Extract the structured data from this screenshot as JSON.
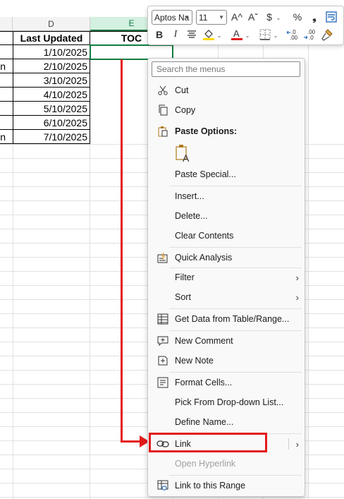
{
  "columns": {
    "d": "D",
    "e": "E"
  },
  "table": {
    "header_last_updated": "Last Updated",
    "header_toc": "TOC",
    "left_fragments": [
      "",
      "on",
      "",
      "",
      "",
      "",
      "n"
    ],
    "dates": [
      "1/10/2025",
      "2/10/2025",
      "3/10/2025",
      "4/10/2025",
      "5/10/2025",
      "6/10/2025",
      "7/10/2025"
    ]
  },
  "mini_toolbar": {
    "font_name": "Aptos Na",
    "font_size": "11",
    "grow_font": "A^",
    "shrink_font": "Aˇ",
    "currency": "$",
    "percent": "%",
    "comma": "❟",
    "bold": "B",
    "italic": "I",
    "font_color_accent": "#e31b1b",
    "highlight_accent": "#ffd800"
  },
  "menu": {
    "search_placeholder": "Search the menus",
    "cut": "Cut",
    "copy": "Copy",
    "paste_options": "Paste Options:",
    "paste_special": "Paste Special...",
    "insert": "Insert...",
    "delete": "Delete...",
    "clear_contents": "Clear Contents",
    "quick_analysis": "Quick Analysis",
    "filter": "Filter",
    "sort": "Sort",
    "get_data": "Get Data from Table/Range...",
    "new_comment": "New Comment",
    "new_note": "New Note",
    "format_cells": "Format Cells...",
    "pick_dropdown": "Pick From Drop-down List...",
    "define_name": "Define Name...",
    "link": "Link",
    "open_hyperlink": "Open Hyperlink",
    "link_to_range": "Link to this Range"
  },
  "colors": {
    "annotation": "#e31b1b",
    "selection": "#107c41"
  }
}
